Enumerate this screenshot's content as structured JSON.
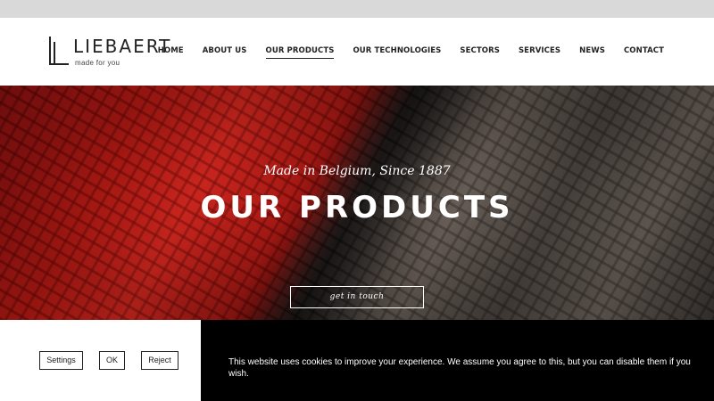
{
  "brand": {
    "name": "LIEBAERT",
    "tagline": "made for you"
  },
  "nav": {
    "items": [
      {
        "label": "HOME",
        "active": false
      },
      {
        "label": "ABOUT US",
        "active": false
      },
      {
        "label": "OUR PRODUCTS",
        "active": true
      },
      {
        "label": "OUR TECHNOLOGIES",
        "active": false
      },
      {
        "label": "SECTORS",
        "active": false
      },
      {
        "label": "SERVICES",
        "active": false
      },
      {
        "label": "NEWS",
        "active": false
      },
      {
        "label": "CONTACT",
        "active": false
      }
    ]
  },
  "hero": {
    "subtitle": "Made in Belgium, Since 1887",
    "title": "OUR PRODUCTS",
    "cta_label": "get in touch"
  },
  "cookie": {
    "settings_label": "Settings",
    "ok_label": "OK",
    "reject_label": "Reject",
    "message": "This website uses cookies to improve your experience. We assume you agree to this, but you can disable them if you wish."
  },
  "colors": {
    "top_bar": "#d9d9d9",
    "text_dark": "#222222",
    "hero_red": "#e2231a",
    "cookie_bg": "#000000"
  }
}
